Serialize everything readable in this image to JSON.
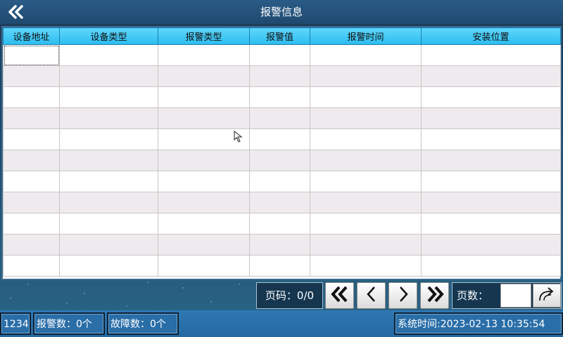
{
  "header": {
    "title": "报警信息",
    "back_icon": "double-chevron-left-icon"
  },
  "table": {
    "columns": [
      "设备地址",
      "设备类型",
      "报警类型",
      "报警值",
      "报警时间",
      "安装位置"
    ],
    "row_count": 11,
    "rows": []
  },
  "pager": {
    "page_label": "页码：0/0",
    "first_icon": "double-chevron-left-icon",
    "prev_icon": "chevron-left-icon",
    "next_icon": "chevron-right-icon",
    "last_icon": "double-chevron-right-icon",
    "pages_label": "页数：",
    "pages_value": "",
    "go_icon": "curved-arrow-right-icon"
  },
  "status": {
    "code": "1234",
    "alarm_count": "报警数：0个",
    "fault_count": "故障数：0个",
    "system_time": "系统时间:2023-02-13 10:35:54"
  },
  "colors": {
    "header_cell": "#2bbcf0",
    "even_row": "#efeaed",
    "status_bar": "#2469a2"
  }
}
